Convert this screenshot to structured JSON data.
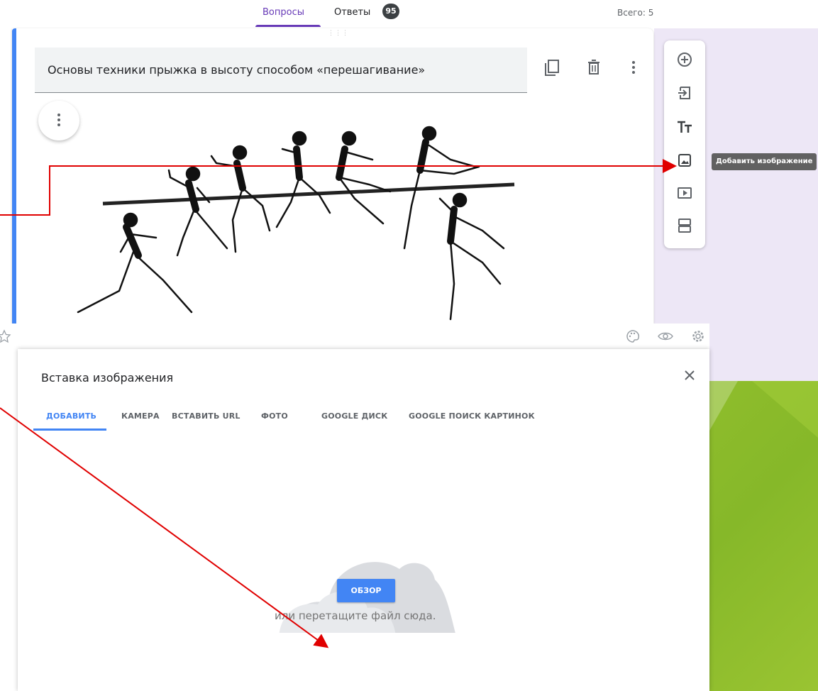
{
  "tabs": {
    "questions": "Вопросы",
    "answers": "Ответы",
    "answers_count": "95",
    "total": "Всего: 5"
  },
  "question": {
    "title": "Основы техники прыжка в высоту способом «перешагивание»"
  },
  "toolbar": {
    "tooltip": "Добавить изображение"
  },
  "dialog": {
    "title": "Вставка изображения",
    "tabs": [
      "ДОБАВИТЬ",
      "КАМЕРА",
      "ВСТАВИТЬ URL",
      "ФОТО",
      "GOOGLE ДИСК",
      "GOOGLE ПОИСК КАРТИНОК"
    ],
    "browse_label": "ОБЗОР",
    "drop_hint": "или перетащите файл сюда."
  },
  "colors": {
    "accent_purple": "#673ab7",
    "accent_blue": "#4285f4",
    "annotation_red": "#e00000",
    "slide_green": "#8fbd2c",
    "lavender": "#ede7f6"
  },
  "icons": [
    "add-question-icon",
    "import-questions-icon",
    "add-title-icon",
    "add-image-icon",
    "add-video-icon",
    "add-section-icon",
    "copy-icon",
    "trash-icon",
    "more-vert-icon",
    "palette-icon",
    "eye-icon",
    "gear-icon",
    "star-icon",
    "close-icon",
    "cloud-icon"
  ]
}
